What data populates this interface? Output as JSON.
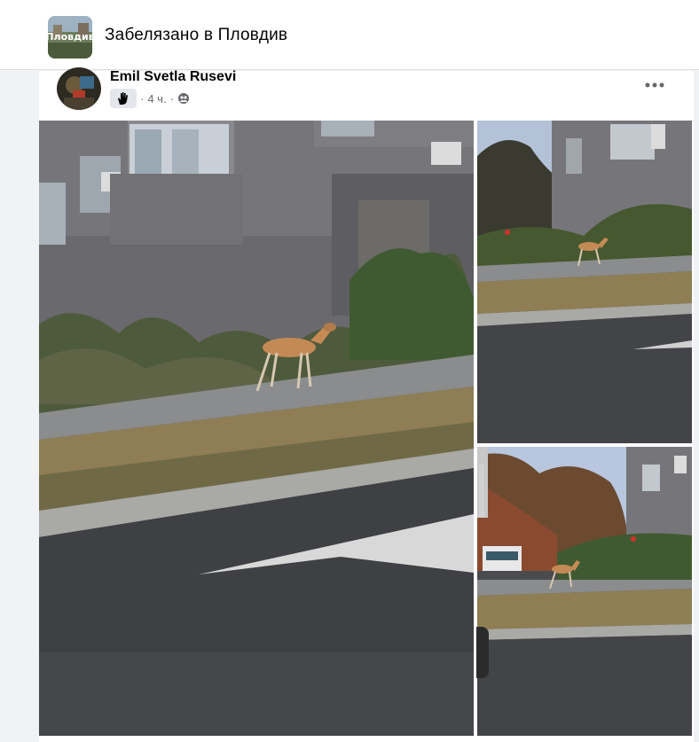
{
  "group": {
    "name": "Забелязано в Пловдив",
    "thumb_text": "Пловдив"
  },
  "post": {
    "author": "Emil Svetla Rusevi",
    "time_sep_left": "·",
    "time": "4 ч.",
    "time_sep_right": "·",
    "audience_icon": "group-audience-icon",
    "badge_icon": "raised-hand-icon"
  },
  "photos": {
    "count": 3,
    "subject": "gazelle on sidewalk"
  },
  "colors": {
    "page_bg": "#f0f2f5",
    "card_bg": "#ffffff",
    "text_primary": "#050505",
    "text_secondary": "#65676b"
  }
}
